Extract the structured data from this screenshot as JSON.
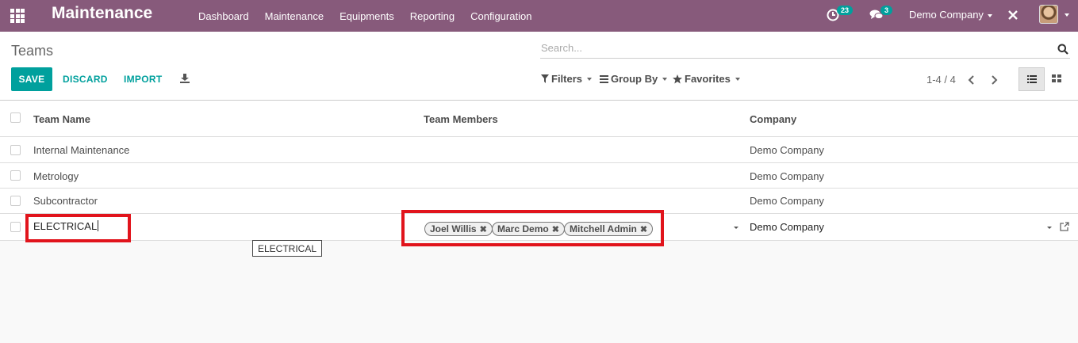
{
  "nav": {
    "brand": "Maintenance",
    "menu": [
      "Dashboard",
      "Maintenance",
      "Equipments",
      "Reporting",
      "Configuration"
    ],
    "activity_count": "23",
    "message_count": "3",
    "company": "Demo Company"
  },
  "control_panel": {
    "breadcrumb": "Teams",
    "search_placeholder": "Search...",
    "save_label": "SAVE",
    "discard_label": "DISCARD",
    "import_label": "IMPORT",
    "filters_label": "Filters",
    "group_by_label": "Group By",
    "favorites_label": "Favorites",
    "pager": "1-4 / 4"
  },
  "table": {
    "columns": [
      "Team Name",
      "Team Members",
      "Company"
    ],
    "rows": [
      {
        "name": "Internal Maintenance",
        "members": "",
        "company": "Demo Company"
      },
      {
        "name": "Metrology",
        "members": "",
        "company": "Demo Company"
      },
      {
        "name": "Subcontractor",
        "members": "",
        "company": "Demo Company"
      }
    ],
    "edit_row": {
      "name": "ELECTRICAL",
      "members": [
        "Joel Willis",
        "Marc Demo",
        "Mitchell Admin"
      ],
      "company": "Demo Company",
      "tooltip": "ELECTRICAL"
    }
  },
  "colors": {
    "navbar": "#875a7b",
    "primary": "#00a09d",
    "highlight": "#e1141c"
  }
}
